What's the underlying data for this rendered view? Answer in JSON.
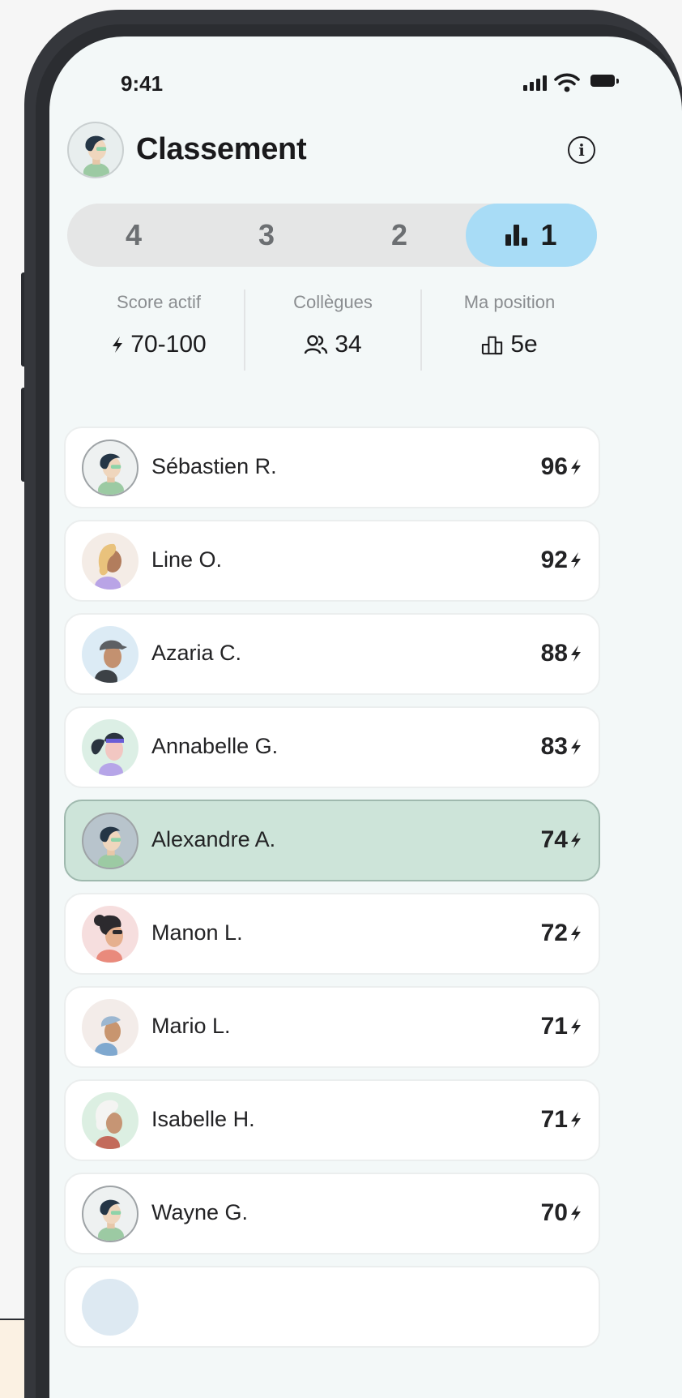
{
  "status_bar": {
    "time": "9:41"
  },
  "header": {
    "title": "Classement"
  },
  "tabs": [
    {
      "label": "4",
      "active": false
    },
    {
      "label": "3",
      "active": false
    },
    {
      "label": "2",
      "active": false
    },
    {
      "label": "1",
      "active": true
    }
  ],
  "stats": [
    {
      "label": "Score actif",
      "value": "70-100",
      "icon": "bolt-icon"
    },
    {
      "label": "Collègues",
      "value": "34",
      "icon": "users-icon"
    },
    {
      "label": "Ma position",
      "value": "5e",
      "icon": "podium-icon"
    }
  ],
  "leaderboard": [
    {
      "name": "Sébastien R.",
      "score": "96",
      "current": false
    },
    {
      "name": "Line O.",
      "score": "92",
      "current": false
    },
    {
      "name": "Azaria C.",
      "score": "88",
      "current": false
    },
    {
      "name": "Annabelle G.",
      "score": "83",
      "current": false
    },
    {
      "name": "Alexandre A.",
      "score": "74",
      "current": true
    },
    {
      "name": "Manon L.",
      "score": "72",
      "current": false
    },
    {
      "name": "Mario L.",
      "score": "71",
      "current": false
    },
    {
      "name": "Isabelle H.",
      "score": "71",
      "current": false
    },
    {
      "name": "Wayne G.",
      "score": "70",
      "current": false
    }
  ],
  "colors": {
    "accent_tab": "#a8dcf6",
    "current_row": "#cde4d9",
    "screen_bg": "#f3f8f8",
    "frame": "#35373c"
  }
}
